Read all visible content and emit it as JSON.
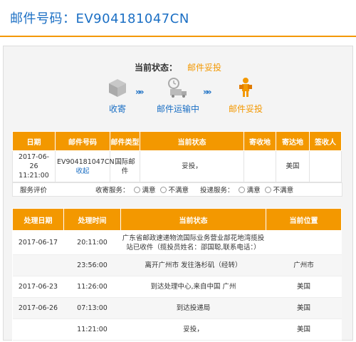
{
  "header": {
    "title": "邮件号码：EV904181047CN"
  },
  "status": {
    "label": "当前状态：",
    "value": "邮件妥投"
  },
  "steps": [
    {
      "label": "收寄",
      "icon": "box-icon"
    },
    {
      "label": "邮件运输中",
      "icon": "truck-clock-icon"
    },
    {
      "label": "邮件妥投",
      "icon": "delivery-person-icon"
    }
  ],
  "arrows": "»»",
  "mail_table": {
    "headers": [
      "日期",
      "邮件号码",
      "邮件类型",
      "当前状态",
      "寄收地",
      "寄达地",
      "签收人"
    ],
    "row": {
      "date": "2017-06-26 11:21:00",
      "number": "EV904181047CN",
      "collapse": "收起",
      "type": "国际邮件",
      "status": "妥投，",
      "origin": "",
      "destination": "美国",
      "signer": ""
    }
  },
  "rating": {
    "label": "服务评价",
    "collect_label": "收寄服务：",
    "deliver_label": "投递服务：",
    "satisfied": "满意",
    "unsatisfied": "不满意"
  },
  "track_table": {
    "headers": [
      "处理日期",
      "处理时间",
      "当前状态",
      "当前位置"
    ],
    "rows": [
      {
        "date": "2017-06-17",
        "time": "20:11:00",
        "status": "广东省邮政速递物流国际业务营业部花地湾揽投站已收件（揽投员姓名：邵国聪,联系电话：）",
        "location": ""
      },
      {
        "date": "",
        "time": "23:56:00",
        "status": "离开广州市 发往洛杉矶（经转）",
        "location": "广州市"
      },
      {
        "date": "2017-06-23",
        "time": "11:26:00",
        "status": "到达处理中心,来自中国 广州",
        "location": "美国"
      },
      {
        "date": "2017-06-26",
        "time": "07:13:00",
        "status": "到达投递局",
        "location": "美国"
      },
      {
        "date": "",
        "time": "11:21:00",
        "status": "妥投，",
        "location": "美国"
      }
    ]
  }
}
